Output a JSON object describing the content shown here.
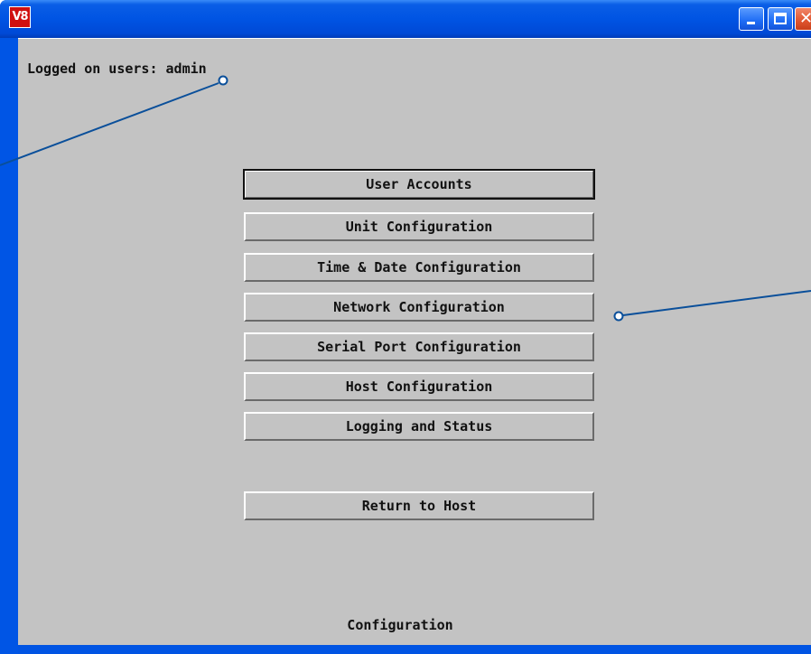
{
  "window": {
    "app_icon_text": "V8",
    "accent_color": "#0054e3",
    "client_color": "#c3c3c3",
    "title_buttons": [
      "minimize-icon",
      "maximize-icon",
      "close-icon"
    ]
  },
  "status": {
    "logged_on_text": "Logged on users: admin"
  },
  "menu": {
    "items": [
      {
        "label": "User Accounts"
      },
      {
        "label": "Unit Configuration"
      },
      {
        "label": "Time & Date Configuration"
      },
      {
        "label": "Network Configuration"
      },
      {
        "label": "Serial Port Configuration"
      },
      {
        "label": "Host Configuration"
      },
      {
        "label": "Logging and Status"
      }
    ],
    "return_label": "Return to Host"
  },
  "footer": {
    "label": "Configuration"
  },
  "callouts": {
    "line_color": "#0a4f9a"
  }
}
